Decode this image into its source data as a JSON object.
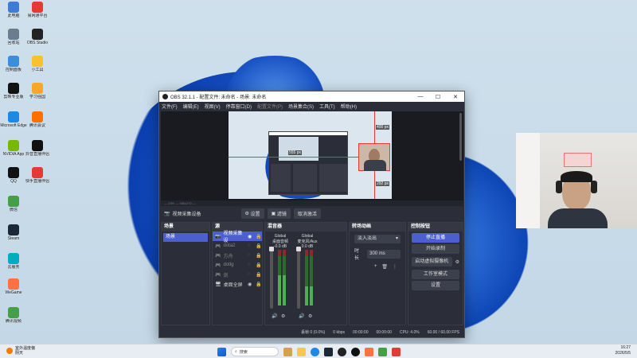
{
  "desktop": {
    "icons": [
      {
        "label": "此电脑",
        "color": "#3b7dd8"
      },
      {
        "label": "易网通平台",
        "color": "#e53935"
      },
      {
        "label": "回收站",
        "color": "#6a7d8e"
      },
      {
        "label": "OBS Studio",
        "color": "#222"
      },
      {
        "label": "控制面板",
        "color": "#3b8ed8"
      },
      {
        "label": "小工具",
        "color": "#fbc02d"
      },
      {
        "label": "剪映专业版",
        "color": "#111"
      },
      {
        "label": "学习强国",
        "color": "#f9a825"
      },
      {
        "label": "Microsoft Edge",
        "color": "#1e88e5"
      },
      {
        "label": "腾讯会议",
        "color": "#ff6f00"
      },
      {
        "label": "NVIDIA App",
        "color": "#76b900"
      },
      {
        "label": "抖音直播伴侣",
        "color": "#111"
      },
      {
        "label": "QQ",
        "color": "#111"
      },
      {
        "label": "快手直播伴侣",
        "color": "#e53935"
      },
      {
        "label": "微信",
        "color": "#43a047"
      },
      {
        "label": "Steam",
        "color": "#1b2838"
      },
      {
        "label": "云服务",
        "color": "#00acc1"
      },
      {
        "label": "WeGame",
        "color": "#ff7043"
      },
      {
        "label": "腾讯视频",
        "color": "#43a047"
      }
    ]
  },
  "obs": {
    "title": "OBS 32.1.1 - 配置文件: 未命名 - 场景: 未命名",
    "menu": [
      "文件(F)",
      "编辑(E)",
      "视图(V)",
      "停靠窗口(D)",
      "配置文件(P)",
      "场景集合(S)",
      "工具(T)",
      "帮助(H)"
    ],
    "preview": {
      "label_top": "400 px",
      "label_right": "292 px",
      "label_mid": "555 px",
      "strip": "— 23% — 480x270 —"
    },
    "source_bar": {
      "label": "视频采集设备",
      "settings": "设置",
      "filters": "滤镜",
      "deactivate": "取消激活"
    },
    "scenes": {
      "header": "场景",
      "items": [
        "场景"
      ]
    },
    "sources": {
      "header": "源",
      "items": [
        {
          "name": "视频采集设",
          "icon": "camera-icon",
          "active": true,
          "dim": false
        },
        {
          "name": "dota2",
          "icon": "gamepad-icon",
          "active": false,
          "dim": true
        },
        {
          "name": "方舟",
          "icon": "gamepad-icon",
          "active": false,
          "dim": true
        },
        {
          "name": "dotlg",
          "icon": "gamepad-icon",
          "active": false,
          "dim": true
        },
        {
          "name": "剑",
          "icon": "gamepad-icon",
          "active": false,
          "dim": true
        },
        {
          "name": "桌面全屏",
          "icon": "monitor-icon",
          "active": false,
          "dim": false
        }
      ]
    },
    "mixer": {
      "header": "混音器",
      "channels": [
        {
          "title": "Global",
          "device": "桌面音频",
          "db": "-0.0 dB",
          "level": 0.55
        },
        {
          "title": "Global",
          "device": "麦克风/Aux",
          "db": "0.0 dB",
          "level": 0.35
        }
      ]
    },
    "transitions": {
      "header": "转场动画",
      "selected": "淡入淡出",
      "duration_label": "时长",
      "duration": "300 ms"
    },
    "controls": {
      "header": "控制按钮",
      "buttons": [
        "停止直播",
        "开始录制",
        "启动虚拟摄像机",
        "工作室模式",
        "设置"
      ]
    },
    "status": {
      "dropped": "丢帧 0 (0.0%)",
      "kbps": "0 kbps",
      "stream_time": "00:00:00",
      "rec_time": "00:00:00",
      "cpu": "CPU: 4.0%",
      "fps": "60.00 / 60.00 FPS"
    }
  },
  "taskbar": {
    "weather_title": "室外温度偏",
    "weather_sub": "阴天",
    "search": "搜索",
    "time": "16:27",
    "date": "2026/5/5"
  }
}
